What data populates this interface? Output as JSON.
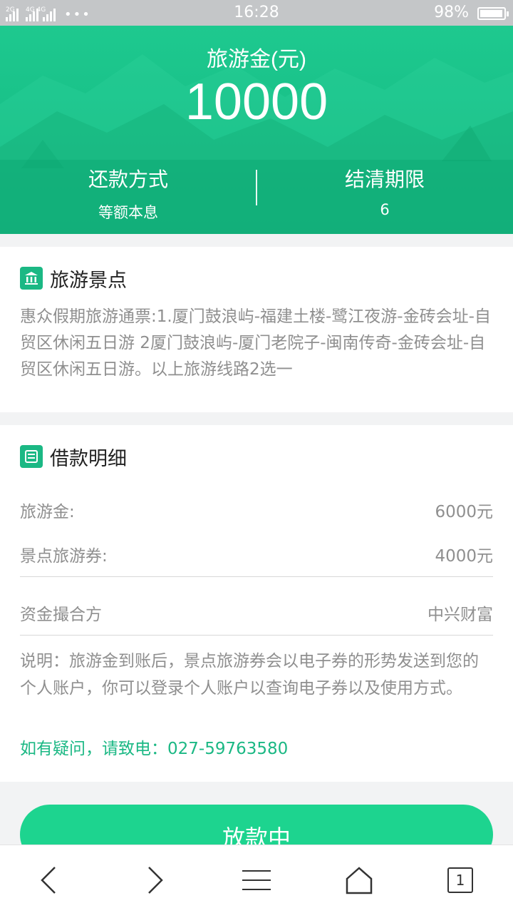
{
  "status_bar": {
    "network_1": "2G",
    "network_2": "4G 4G",
    "time": "16:28",
    "battery": "98%"
  },
  "hero": {
    "label": "旅游金(元)",
    "amount": "10000",
    "repay_title": "还款方式",
    "repay_value": "等额本息",
    "term_title": "结清期限",
    "term_value": "6"
  },
  "scenic": {
    "title": "旅游景点",
    "description": "惠众假期旅游通票:1.厦门鼓浪屿-福建土楼-鹭江夜游-金砖会址-自贸区休闲五日游 2厦门鼓浪屿-厦门老院子-闽南传奇-金砖会址-自贸区休闲五日游。以上旅游线路2选一"
  },
  "loan": {
    "title": "借款明细",
    "rows": [
      {
        "label": "旅游金:",
        "value": "6000元"
      },
      {
        "label": "景点旅游券:",
        "value": "4000元"
      },
      {
        "label": "资金撮合方",
        "value": "中兴财富"
      }
    ],
    "note": "说明：旅游金到账后，景点旅游券会以电子券的形势发送到您的个人账户，你可以登录个人账户以查询电子券以及使用方式。",
    "hotline": "如有疑问，请致电：027-59763580"
  },
  "cta": {
    "label": "放款中"
  },
  "bottom_nav": {
    "tab_count": "1"
  },
  "colors": {
    "primary": "#1bb884",
    "hero": "#17be86",
    "button": "#1dd48f"
  }
}
